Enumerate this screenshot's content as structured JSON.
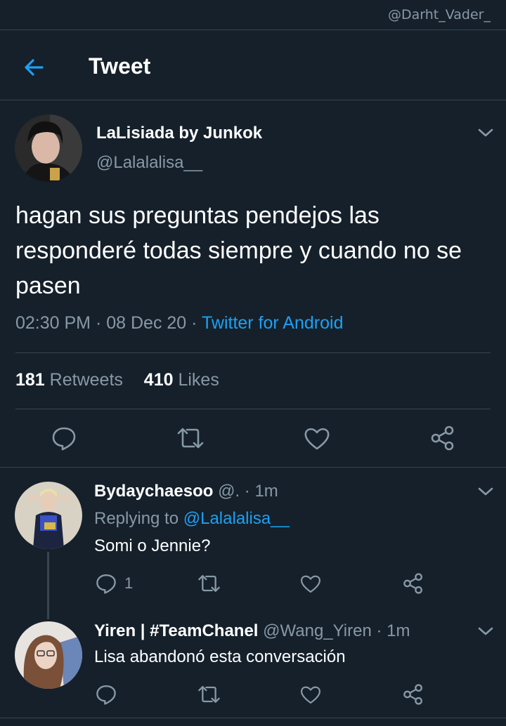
{
  "watermark": "@Darht_Vader_",
  "header": {
    "title": "Tweet"
  },
  "tweet": {
    "author_name": "LaLisiada by Junkok",
    "author_handle": "@Lalalalisa__",
    "text": "hagan sus preguntas pendejos las responderé todas siempre y cuando no se pasen",
    "time": "02:30 PM",
    "date": "08 Dec 20",
    "source": "Twitter for Android",
    "retweets_count": "181",
    "retweets_label": "Retweets",
    "likes_count": "410",
    "likes_label": "Likes"
  },
  "replies": [
    {
      "name": "Bydaychaesoo",
      "handle": "@.",
      "time": "1m",
      "replying_label": "Replying to",
      "replying_handle": "@Lalalalisa__",
      "text": "Somi o Jennie?",
      "reply_count": "1"
    },
    {
      "name": "Yiren | #TeamChanel",
      "handle": "@Wang_Yiren",
      "time": "1m",
      "text": "Lisa abandonó esta conversación"
    }
  ],
  "icons": {
    "back": "arrow-left-icon",
    "chevron": "chevron-down-icon",
    "reply": "comment-icon",
    "retweet": "retweet-icon",
    "like": "heart-icon",
    "share": "share-icon"
  },
  "colors": {
    "background": "#15202b",
    "accent": "#1da1f2",
    "muted": "#8899a6",
    "divider": "#38444d"
  }
}
